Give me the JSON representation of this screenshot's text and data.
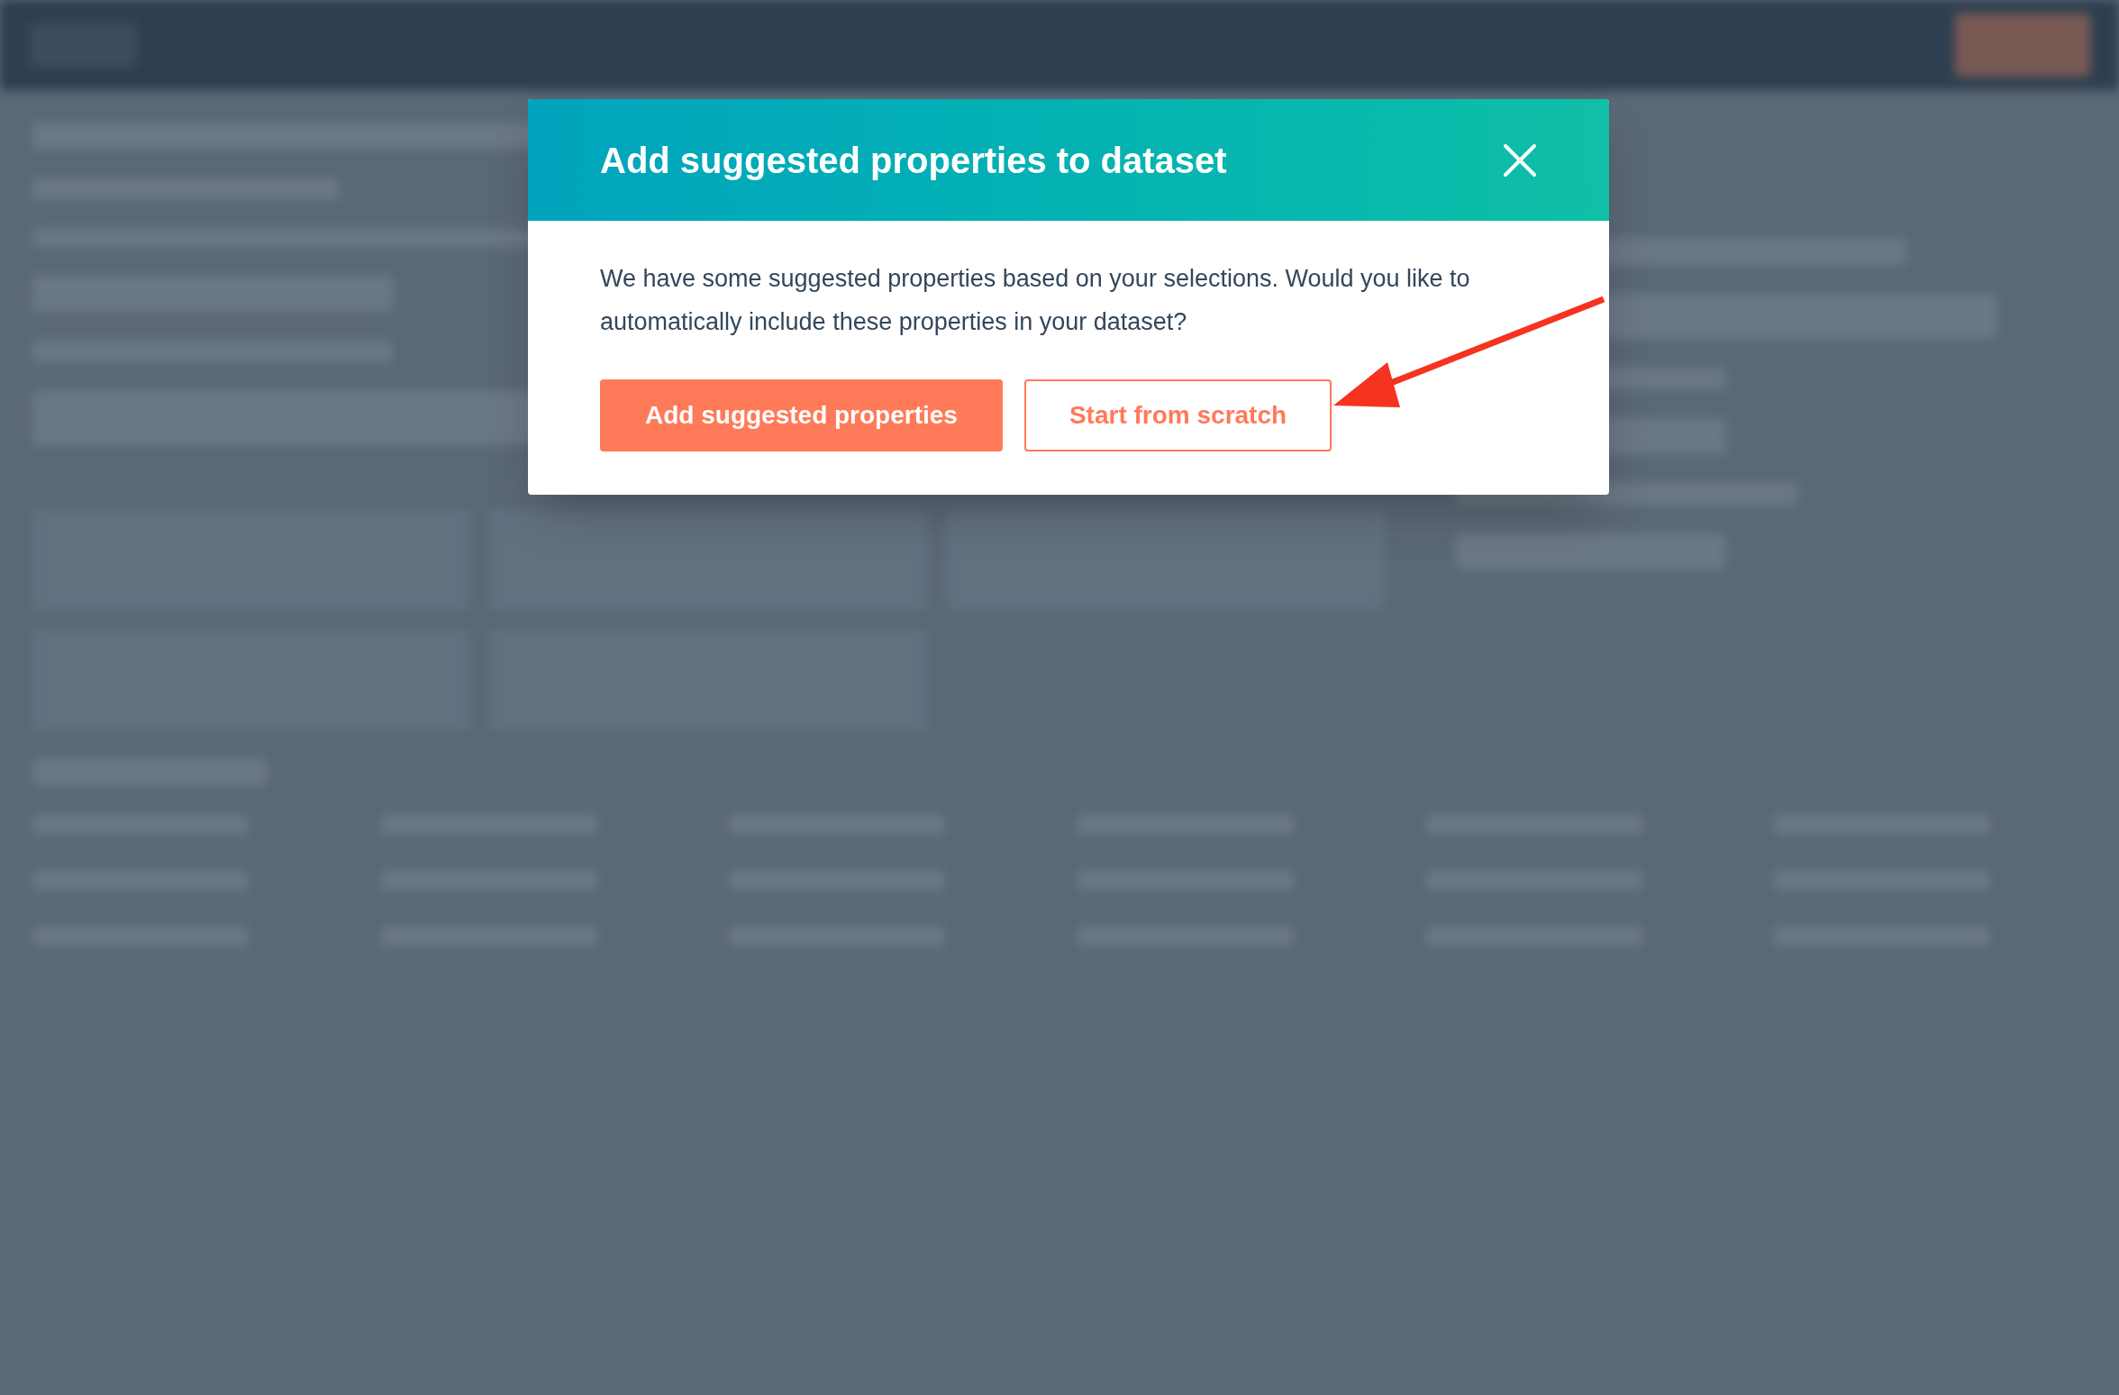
{
  "dialog": {
    "title": "Add suggested properties to dataset",
    "message": "We have some suggested properties based on your selections. Would you like to automatically include these properties in your dataset?",
    "buttons": [
      {
        "label": "Add suggested properties",
        "kind": "primary"
      },
      {
        "label": "Start from scratch",
        "kind": "secondary"
      }
    ]
  }
}
